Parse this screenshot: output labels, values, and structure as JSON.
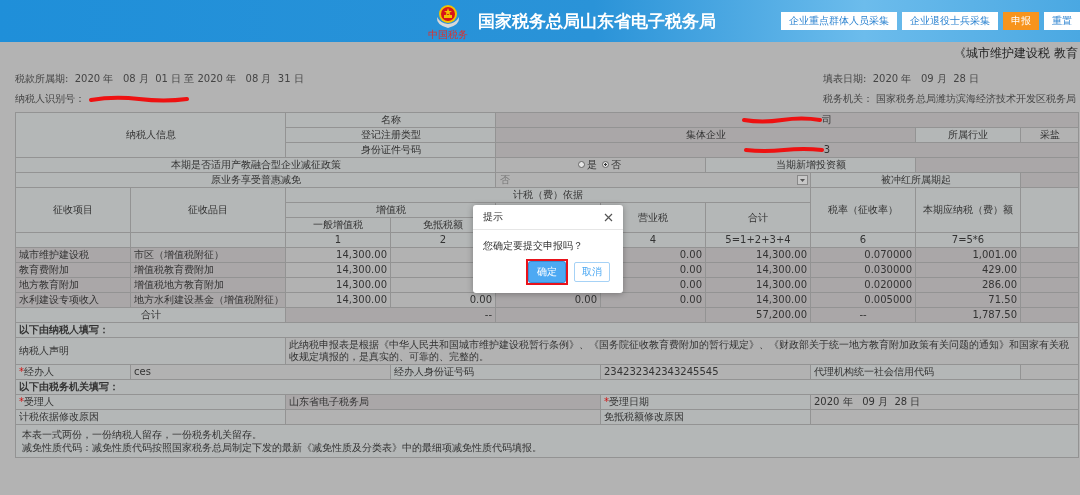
{
  "header": {
    "title": "国家税务总局山东省电子税务局",
    "emblem_caption": "中国税务",
    "buttons": [
      {
        "label": "企业重点群体人员采集",
        "kind": "outline"
      },
      {
        "label": "企业退役士兵采集",
        "kind": "outline"
      },
      {
        "label": "申报",
        "kind": "primary"
      },
      {
        "label": "重置",
        "kind": "outline"
      }
    ]
  },
  "form": {
    "title": "《城市维护建设税 教育",
    "period": {
      "label": "税款所属期:",
      "value": "2020 年   08 月  01 日 至 2020 年   08 月  31 日"
    },
    "fill_date": {
      "label": "填表日期:",
      "value": "2020 年   09 月  28 日"
    },
    "taxpayer_id": {
      "label": "纳税人识别号："
    },
    "tax_authority": {
      "label": "税务机关：",
      "value": "国家税务总局潍坊滨海经济技术开发区税务局"
    }
  },
  "info": {
    "section_label": "纳税人信息",
    "name": {
      "label": "名称",
      "value": "司"
    },
    "reg_type": {
      "label": "登记注册类型",
      "value": "集体企业"
    },
    "industry": {
      "label": "所属行业",
      "value": "采盐"
    },
    "id_number": {
      "label": "身份证件号码",
      "value": "3"
    }
  },
  "policy": {
    "label": "本期是否适用产教融合型企业减征政策",
    "options": [
      {
        "label": "是",
        "selected": false
      },
      {
        "label": "否",
        "selected": true
      }
    ],
    "investment_label": "当期新增投资额"
  },
  "relief": {
    "label": "原业务享受普惠减免",
    "value": "否",
    "start_label": "被冲红所属期起"
  },
  "columns": {
    "item": "征收项目",
    "subitem": "征收品目",
    "basis": "计税（费）依据",
    "vat": "增值税",
    "general_vat": "一般增值税",
    "exempt": "免抵税额",
    "business_tax": "营业税",
    "total": "合计",
    "rate": "税率（征收率）",
    "payable": "本期应纳税（费）额",
    "numbers": [
      "1",
      "2",
      "4",
      "5=1+2+3+4",
      "6",
      "7=5*6"
    ]
  },
  "rows": [
    {
      "item": "城市维护建设税",
      "subitem": "市区（增值税附征）",
      "general_vat": "14,300.00",
      "business_tax": "0.00",
      "total": "14,300.00",
      "rate": "0.070000",
      "payable": "1,001.00"
    },
    {
      "item": "教育费附加",
      "subitem": "增值税教育费附加",
      "general_vat": "14,300.00",
      "business_tax": "0.00",
      "total": "14,300.00",
      "rate": "0.030000",
      "payable": "429.00"
    },
    {
      "item": "地方教育附加",
      "subitem": "增值税地方教育附加",
      "general_vat": "14,300.00",
      "business_tax": "0.00",
      "total": "14,300.00",
      "rate": "0.020000",
      "payable": "286.00"
    },
    {
      "item": "水利建设专项收入",
      "subitem": "地方水利建设基金（增值税附征）",
      "general_vat": "14,300.00",
      "exempt": "0.00",
      "column_3": "0.00",
      "business_tax": "0.00",
      "total": "14,300.00",
      "rate": "0.005000",
      "payable": "71.50"
    }
  ],
  "totals": {
    "label": "合计",
    "basis": "--",
    "total": "57,200.00",
    "rate": "--",
    "payable": "1,787.50"
  },
  "taxpayer_section": {
    "heading": "以下由纳税人填写：",
    "declaration_label": "纳税人声明",
    "declaration": "此纳税申报表是根据《中华人民共和国城市维护建设税暂行条例》、《国务院征收教育费附加的暂行规定》、《财政部关于统一地方教育附加政策有关问题的通知》和国家有关税收规定填报的，是真实的、可靠的、完整的。",
    "agent": {
      "mark": "*",
      "label": "经办人",
      "value": "ces"
    },
    "agent_id": {
      "label": "经办人身份证号码",
      "value": "234232342343245545"
    },
    "agency_code_label": "代理机构统一社会信用代码"
  },
  "authority_section": {
    "heading": "以下由税务机关填写：",
    "receiver": {
      "mark": "*",
      "label": "受理人",
      "value": "山东省电子税务局"
    },
    "receive_date": {
      "mark": "*",
      "label": "受理日期",
      "value": "2020 年   09 月  28 日"
    },
    "basis_reason_label": "计税依据修改原因",
    "exempt_reason_label": "免抵税额修改原因"
  },
  "notes": [
    "本表一式两份，一份纳税人留存，一份税务机关留存。",
    "减免性质代码：减免性质代码按照国家税务总局制定下发的最新《减免性质及分类表》中的最细项减免性质代码填报。"
  ],
  "dialog": {
    "title": "提示",
    "message": "您确定要提交申报吗？",
    "buttons": [
      {
        "label": "确定",
        "kind": "primary",
        "highlighted": true
      },
      {
        "label": "取消",
        "kind": "secondary",
        "highlighted": false
      }
    ]
  }
}
